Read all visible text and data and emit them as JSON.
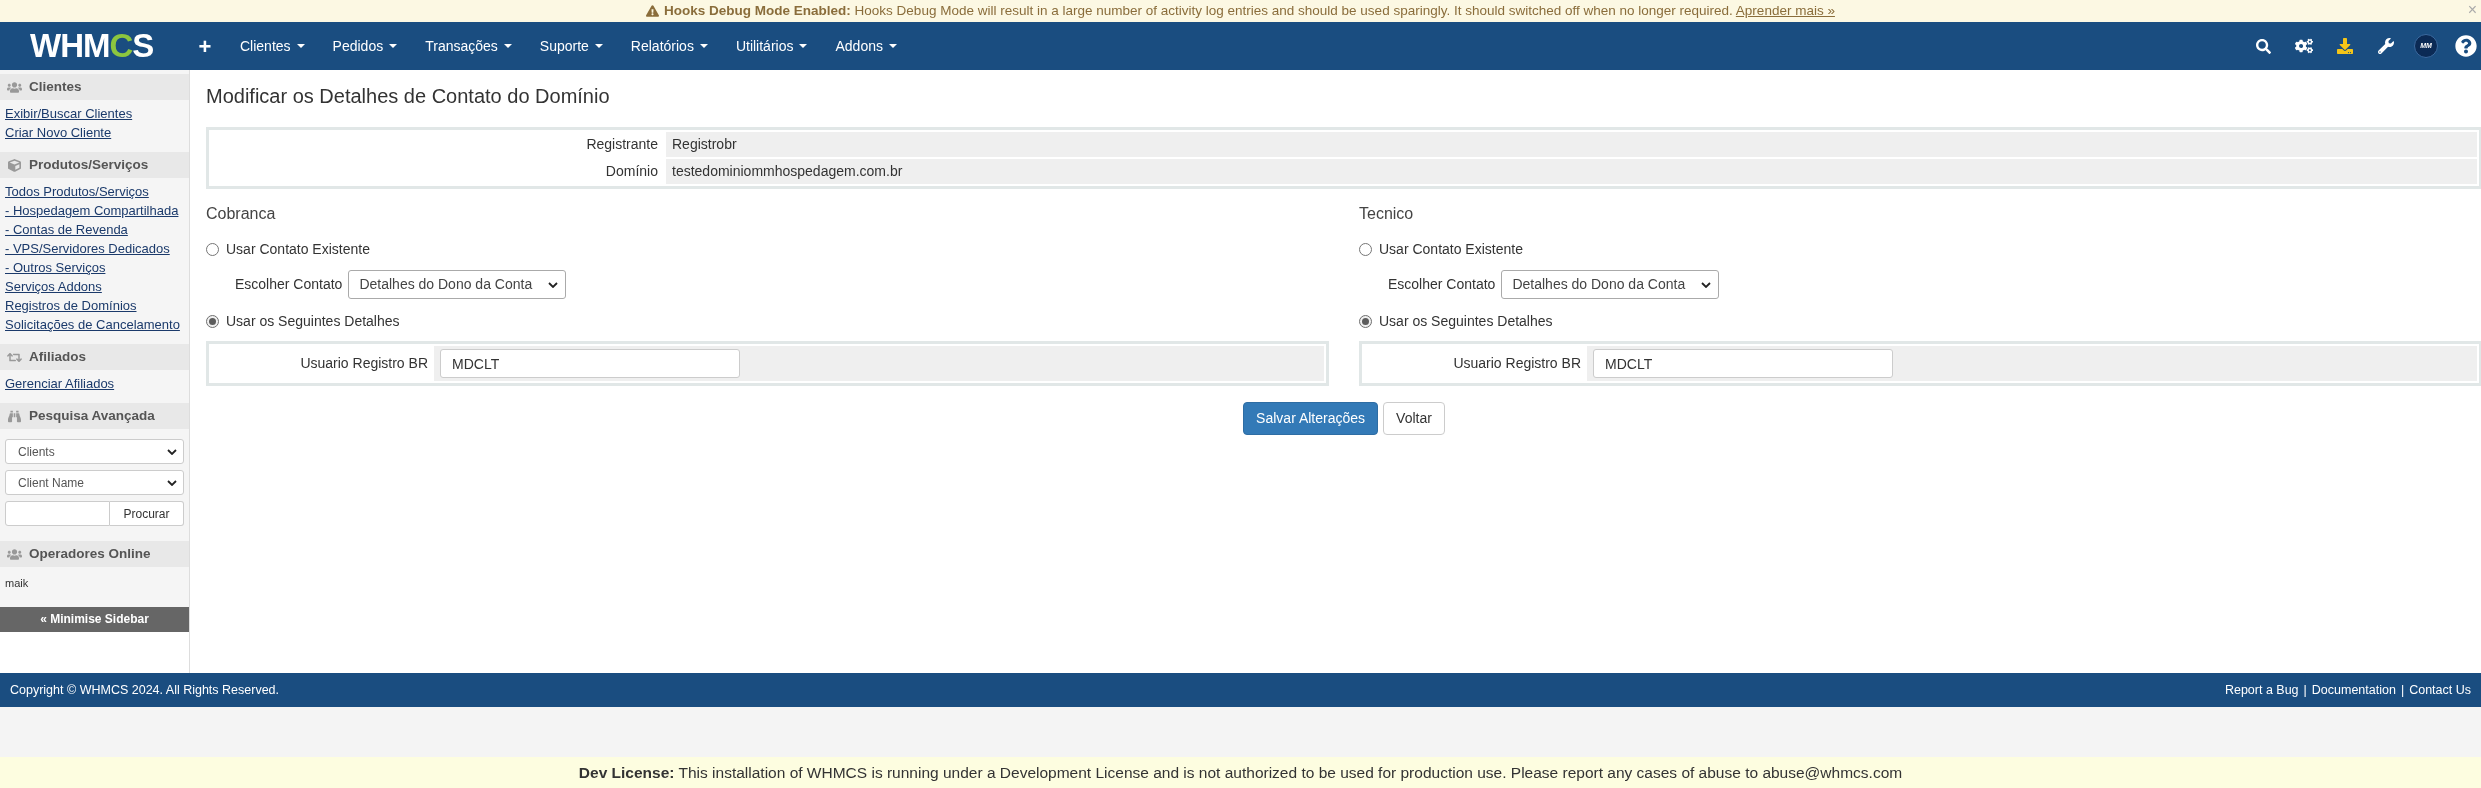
{
  "notice": {
    "text": "**Hooks Debug Mode Enabled:** Hooks Debug Mode will result in a large number of activity log entries and should be used sparingly. It should switched off when no longer required.",
    "link": "Aprender mais »",
    "close": "×"
  },
  "navbar": {
    "logo": "WHMCS",
    "add": "+",
    "menu": [
      "Clientes",
      "Pedidos",
      "Transações",
      "Suporte",
      "Relatórios",
      "Utilitários",
      "Addons"
    ],
    "avatar": "MM"
  },
  "sidebar": {
    "sections": [
      {
        "kind": "links",
        "title": "Clientes",
        "links": [
          "Exibir/Buscar Clientes",
          "Criar Novo Cliente"
        ]
      },
      {
        "kind": "links",
        "title": "Produtos/Serviços",
        "links": [
          "Todos Produtos/Serviços",
          "- Hospedagem Compartilhada",
          "- Contas de Revenda",
          "- VPS/Servidores Dedicados",
          "- Outros Serviços",
          "Serviços Addons",
          "Registros de Domínios",
          "Solicitações de Cancelamento"
        ]
      },
      {
        "kind": "links",
        "title": "Afiliados",
        "links": [
          "Gerenciar Afiliados"
        ]
      },
      {
        "kind": "search",
        "title": "Pesquisa Avançada",
        "selects": [
          "Clients",
          "Client Name"
        ],
        "button": "Procurar"
      },
      {
        "kind": "text",
        "title": "Operadores Online",
        "items": [
          "maik"
        ]
      }
    ],
    "minimise": "« Minimise Sidebar"
  },
  "page": {
    "title": "Modificar os Detalhes de Contato do Domínio",
    "info": [
      {
        "label": "Registrante",
        "value": "Registrobr"
      },
      {
        "label": "Domínio",
        "value": "testedominiommhospedagem.com.br"
      }
    ],
    "contacts": [
      {
        "title": "Cobranca",
        "options": [
          {
            "kind": "existing",
            "label": "Usar Contato Existente",
            "selected": false,
            "select_label": "Escolher Contato",
            "select_value": "Detalhes do Dono da Conta"
          },
          {
            "kind": "details",
            "label": "Usar os Seguintes Detalhes",
            "selected": true,
            "fields": [
              {
                "label": "Usuario Registro BR",
                "value": "MDCLT"
              }
            ]
          }
        ]
      },
      {
        "title": "Tecnico",
        "options": [
          {
            "kind": "existing",
            "label": "Usar Contato Existente",
            "selected": false,
            "select_label": "Escolher Contato",
            "select_value": "Detalhes do Dono da Conta"
          },
          {
            "kind": "details",
            "label": "Usar os Seguintes Detalhes",
            "selected": true,
            "fields": [
              {
                "label": "Usuario Registro BR",
                "value": "MDCLT"
              }
            ]
          }
        ]
      }
    ],
    "buttons": [
      {
        "kind": "primary",
        "label": "Salvar Alterações"
      },
      {
        "kind": "default",
        "label": "Voltar"
      }
    ]
  },
  "footer": {
    "copyright": "Copyright © WHMCS 2024. All Rights Reserved.",
    "links": [
      "Report a Bug",
      "Documentation",
      "Contact Us"
    ],
    "separators": [
      "|",
      "|"
    ]
  },
  "dev_license": "**Dev License:** This installation of WHMCS is running under a Development License and is not authorized to be used for production use. Please report any cases of abuse to abuse@whmcs.com"
}
